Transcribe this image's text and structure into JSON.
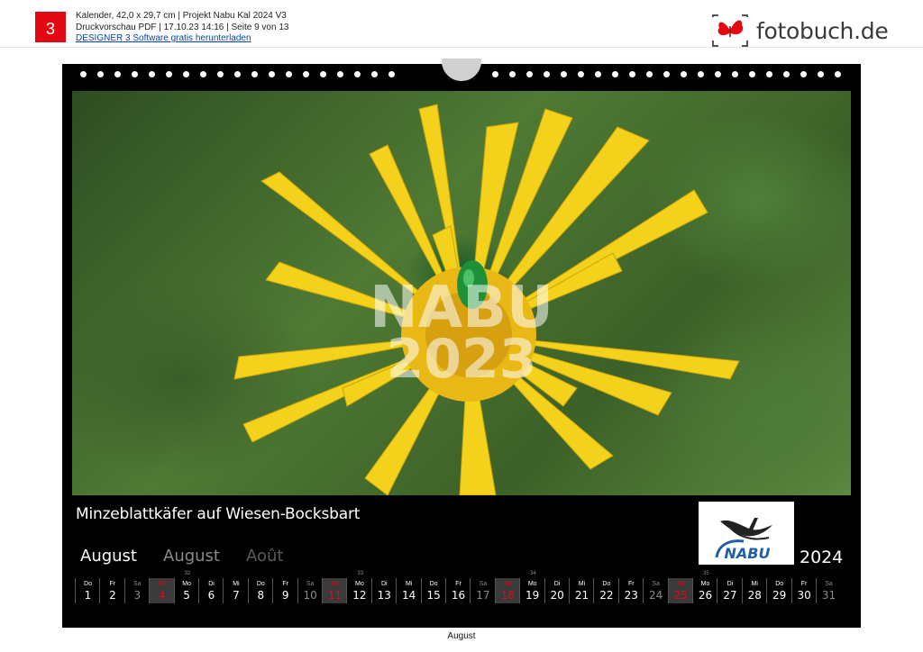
{
  "header": {
    "badge": "3",
    "line1": "Kalender, 42,0 x 29,7 cm | Projekt Nabu Kal 2024 V3",
    "line2": "Druckvorschau PDF | 17.10.23 14:16 | Seite 9 von 13",
    "link": "DESIGNER 3 Software gratis herunterladen",
    "brand": "fotobuch.de",
    "brand_color": "#e30613"
  },
  "calendar": {
    "caption": "Minzeblattkäfer auf Wiesen-Bocksbart",
    "watermark_top": "NABU",
    "watermark_bottom": "2023",
    "logo_text": "NABU",
    "months": [
      "August",
      "August",
      "Août"
    ],
    "year": "2024",
    "week_numbers": [
      "32",
      "33",
      "34",
      "35"
    ],
    "days": [
      {
        "n": "Do",
        "d": "1"
      },
      {
        "n": "Fr",
        "d": "2"
      },
      {
        "n": "Sa",
        "d": "3"
      },
      {
        "n": "So",
        "d": "4"
      },
      {
        "n": "Mo",
        "d": "5"
      },
      {
        "n": "Di",
        "d": "6"
      },
      {
        "n": "Mi",
        "d": "7"
      },
      {
        "n": "Do",
        "d": "8"
      },
      {
        "n": "Fr",
        "d": "9"
      },
      {
        "n": "Sa",
        "d": "10"
      },
      {
        "n": "So",
        "d": "11"
      },
      {
        "n": "Mo",
        "d": "12"
      },
      {
        "n": "Di",
        "d": "13"
      },
      {
        "n": "Mi",
        "d": "14"
      },
      {
        "n": "Do",
        "d": "15"
      },
      {
        "n": "Fr",
        "d": "16"
      },
      {
        "n": "Sa",
        "d": "17"
      },
      {
        "n": "So",
        "d": "18"
      },
      {
        "n": "Mo",
        "d": "19"
      },
      {
        "n": "Di",
        "d": "20"
      },
      {
        "n": "Mi",
        "d": "21"
      },
      {
        "n": "Do",
        "d": "22"
      },
      {
        "n": "Fr",
        "d": "23"
      },
      {
        "n": "Sa",
        "d": "24"
      },
      {
        "n": "So",
        "d": "25"
      },
      {
        "n": "Mo",
        "d": "26"
      },
      {
        "n": "Di",
        "d": "27"
      },
      {
        "n": "Mi",
        "d": "28"
      },
      {
        "n": "Do",
        "d": "29"
      },
      {
        "n": "Fr",
        "d": "30"
      },
      {
        "n": "Sa",
        "d": "31"
      }
    ]
  },
  "footer": {
    "label": "August"
  }
}
